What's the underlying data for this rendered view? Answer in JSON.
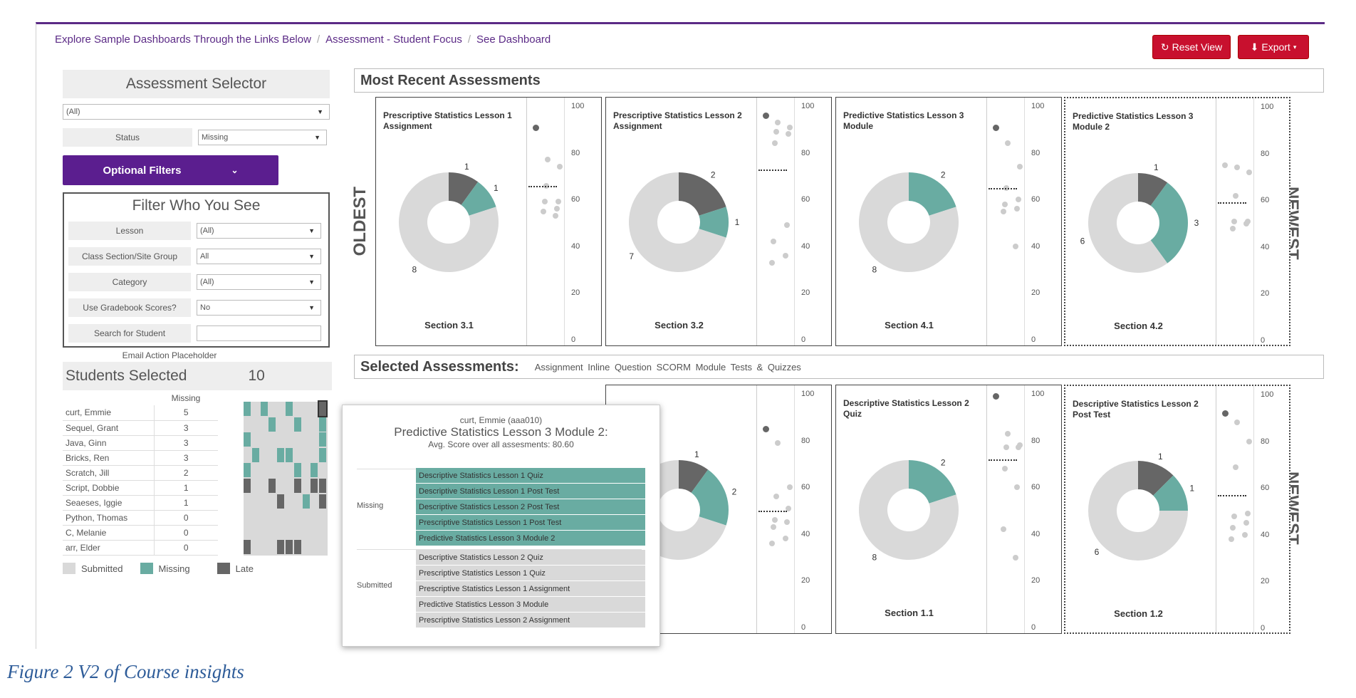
{
  "breadcrumb": [
    "Explore Sample Dashboards Through the Links Below",
    "Assessment - Student Focus",
    "See Dashboard"
  ],
  "toolbar": {
    "reset_label": "Reset View",
    "export_label": "Export"
  },
  "selector": {
    "title": "Assessment Selector",
    "assessment_value": "(All)",
    "status_label": "Status",
    "status_value": "Missing",
    "optional_filters_label": "Optional Filters"
  },
  "filters": {
    "title": "Filter Who You See",
    "rows": [
      {
        "label": "Lesson",
        "value": "(All)"
      },
      {
        "label": "Class Section/Site Group",
        "value": "All"
      },
      {
        "label": "Category",
        "value": "(All)"
      },
      {
        "label": "Use Gradebook Scores?",
        "value": "No"
      }
    ],
    "search_label": "Search for Student",
    "search_value": ""
  },
  "email_placeholder": "Email Action Placeholder",
  "students": {
    "title": "Students Selected",
    "count": "10",
    "column": "Missing",
    "rows": [
      {
        "name": "curt, Emmie",
        "missing": "5"
      },
      {
        "name": "Sequel, Grant",
        "missing": "3"
      },
      {
        "name": "Java, Ginn",
        "missing": "3"
      },
      {
        "name": "Bricks, Ren",
        "missing": "3"
      },
      {
        "name": "Scratch, Jill",
        "missing": "2"
      },
      {
        "name": "Script, Dobbie",
        "missing": "1"
      },
      {
        "name": "Seaeses, Iggie",
        "missing": "1"
      },
      {
        "name": "Python, Thomas",
        "missing": "0"
      },
      {
        "name": "C, Melanie",
        "missing": "0"
      },
      {
        "name": "arr, Elder",
        "missing": "0"
      }
    ],
    "grid_status": [
      [
        "M",
        "S",
        "M",
        "S",
        "S",
        "M",
        "S",
        "S",
        "S",
        "L"
      ],
      [
        "S",
        "S",
        "S",
        "M",
        "S",
        "S",
        "M",
        "S",
        "S",
        "M"
      ],
      [
        "M",
        "S",
        "S",
        "S",
        "S",
        "S",
        "S",
        "S",
        "S",
        "M"
      ],
      [
        "S",
        "M",
        "S",
        "S",
        "M",
        "M",
        "S",
        "S",
        "S",
        "M"
      ],
      [
        "M",
        "S",
        "S",
        "S",
        "S",
        "S",
        "M",
        "S",
        "M",
        "S"
      ],
      [
        "L",
        "S",
        "S",
        "L",
        "S",
        "S",
        "L",
        "S",
        "L",
        "L"
      ],
      [
        "S",
        "S",
        "S",
        "S",
        "L",
        "S",
        "S",
        "M",
        "S",
        "L"
      ],
      [
        "S",
        "S",
        "S",
        "S",
        "S",
        "S",
        "S",
        "S",
        "S",
        "S"
      ],
      [
        "S",
        "S",
        "S",
        "S",
        "S",
        "S",
        "S",
        "S",
        "S",
        "S"
      ],
      [
        "L",
        "S",
        "S",
        "S",
        "L",
        "L",
        "L",
        "S",
        "S",
        "S"
      ]
    ]
  },
  "legend": [
    {
      "label": "Submitted",
      "color": "#d9d9d9"
    },
    {
      "label": "Missing",
      "color": "#69aca2"
    },
    {
      "label": "Late",
      "color": "#666666"
    }
  ],
  "recent": {
    "title": "Most Recent Assessments",
    "oldest_label": "OLDEST",
    "newest_label": "NEWEST"
  },
  "selected": {
    "title": "Selected Assessments:",
    "types": "Assignment  Inline Question  SCORM Module  Tests & Quizzes",
    "newest_label": "NEWEST"
  },
  "axis_ticks": [
    "100",
    "80",
    "60",
    "40",
    "20",
    "0"
  ],
  "colors": {
    "submitted": "#d9d9d9",
    "missing": "#69aca2",
    "late": "#666666",
    "brand": "#5b1e8f",
    "danger": "#c8102e"
  },
  "chart_data": [
    {
      "type": "pie",
      "title": "Prescriptive Statistics Lesson 1 Assignment",
      "section": "Section 3.1",
      "labels": [
        "Submitted",
        "Missing",
        "Late"
      ],
      "values": [
        8,
        1,
        1
      ],
      "scores": [
        91,
        77,
        74,
        66,
        59,
        59,
        56,
        55,
        53
      ],
      "avg": 66
    },
    {
      "type": "pie",
      "title": "Prescriptive Statistics Lesson 2 Assignment",
      "section": "Section 3.2",
      "labels": [
        "Submitted",
        "Missing",
        "Late"
      ],
      "values": [
        7,
        1,
        2
      ],
      "scores": [
        96,
        93,
        91,
        89,
        88,
        84,
        49,
        42,
        36,
        33
      ],
      "avg": 73
    },
    {
      "type": "pie",
      "title": "Predictive Statistics Lesson 3 Module",
      "section": "Section 4.1",
      "labels": [
        "Submitted",
        "Missing",
        "Late"
      ],
      "values": [
        8,
        2,
        0
      ],
      "scores": [
        91,
        84,
        74,
        65,
        60,
        58,
        56,
        55,
        40
      ],
      "avg": 65
    },
    {
      "type": "pie",
      "title": "Predictive Statistics Lesson 3 Module 2",
      "section": "Section 4.2",
      "labels": [
        "Submitted",
        "Missing",
        "Late"
      ],
      "values": [
        6,
        3,
        1
      ],
      "scores": [
        75,
        74,
        72,
        62,
        51,
        51,
        50,
        48
      ],
      "avg": 59
    },
    {
      "type": "pie",
      "title": "",
      "section": "",
      "labels": [
        "Submitted",
        "Missing",
        "Late"
      ],
      "values": [
        7,
        2,
        1
      ],
      "scores": [
        85,
        79,
        60,
        56,
        51,
        46,
        45,
        43,
        38,
        36
      ],
      "avg": 50
    },
    {
      "type": "pie",
      "title": "Descriptive Statistics Lesson 2 Quiz",
      "section": "Section 1.1",
      "labels": [
        "Submitted",
        "Missing",
        "Late"
      ],
      "values": [
        8,
        2,
        0
      ],
      "scores": [
        99,
        83,
        78,
        77,
        77,
        68,
        60,
        42,
        30
      ],
      "avg": 72
    },
    {
      "type": "pie",
      "title": "Descriptive Statistics Lesson 2 Post Test",
      "section": "Section 1.2",
      "labels": [
        "Submitted",
        "Missing",
        "Late"
      ],
      "values": [
        6,
        1,
        1
      ],
      "scores": [
        92,
        88,
        80,
        69,
        49,
        48,
        45,
        43,
        40,
        38
      ],
      "avg": 57
    }
  ],
  "partial_card": {
    "title_tail": "ive Statistics",
    "title_tail2": "Post Test",
    "section_tail": "on 1.2",
    "label_late": "1",
    "label_missing": "2"
  },
  "tooltip": {
    "student": "curt, Emmie (aaa010)",
    "title": "Predictive Statistics Lesson 3 Module 2:",
    "avg": "Avg. Score over all assesments: 80.60",
    "missing_label": "Missing",
    "missing": [
      "Descriptive Statistics Lesson 1 Quiz",
      "Descriptive Statistics Lesson 1 Post Test",
      "Descriptive Statistics Lesson 2 Post Test",
      "Prescriptive Statistics Lesson 1 Post Test",
      "Predictive Statistics Lesson 3 Module 2"
    ],
    "submitted_label": "Submitted",
    "submitted": [
      "Descriptive Statistics Lesson 2 Quiz",
      "Prescriptive Statistics Lesson 1 Quiz",
      "Prescriptive Statistics Lesson 1 Assignment",
      "Predictive Statistics Lesson 3 Module",
      "Prescriptive Statistics Lesson 2 Assignment"
    ]
  },
  "caption": "Figure 2 V2 of Course insights"
}
